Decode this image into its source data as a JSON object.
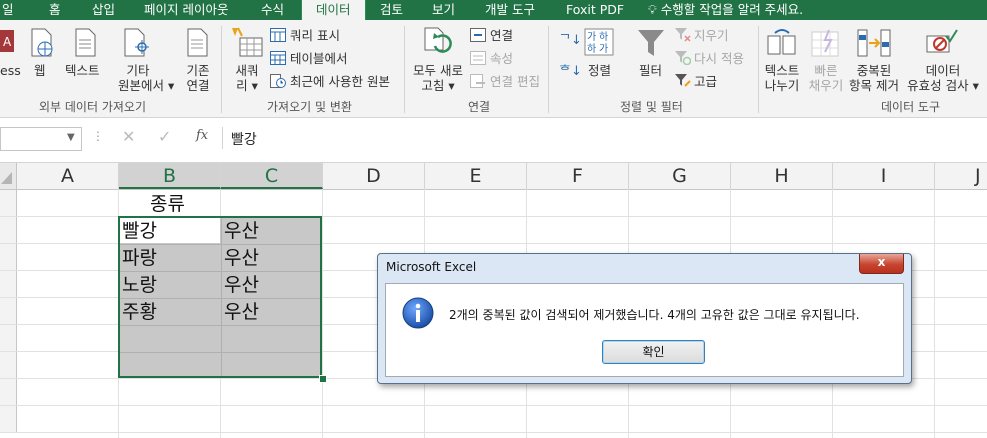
{
  "tabs": [
    {
      "label": "일"
    },
    {
      "label": "홈"
    },
    {
      "label": "삽입"
    },
    {
      "label": "페이지 레이아웃"
    },
    {
      "label": "수식"
    },
    {
      "label": "데이터"
    },
    {
      "label": "검토"
    },
    {
      "label": "보기"
    },
    {
      "label": "개발 도구"
    },
    {
      "label": "Foxit PDF"
    }
  ],
  "tell_me": "수행할 작업을 알려 주세요.",
  "ribbon": {
    "ext": {
      "access": "ess",
      "web": "웹",
      "text": "텍스트",
      "other": [
        "기타",
        "원본에서 ▾"
      ],
      "existing": [
        "기존",
        "연결"
      ],
      "group": "외부 데이터 가져오기"
    },
    "get": {
      "new": [
        "새쿼",
        "리 ▾"
      ],
      "show_query": "쿼리 표시",
      "from_table": "테이블에서",
      "recent": "최근에 사용한 원본",
      "group": "가져오기 및 변환"
    },
    "conn": {
      "refresh": [
        "모두 새로",
        "고침 ▾"
      ],
      "connections": "연결",
      "properties": "속성",
      "edit_links": "연결 편집",
      "group": "연결"
    },
    "sort": {
      "sort": "정렬",
      "filter": "필터",
      "clear": "지우기",
      "reapply": "다시 적용",
      "advanced": "고급",
      "group": "정렬 및 필터"
    },
    "tools": {
      "text_to_col": [
        "텍스트",
        "나누기"
      ],
      "flash": [
        "빠른",
        "채우기"
      ],
      "remove_dup": [
        "중복된",
        "항목 제거"
      ],
      "validation": [
        "데이터",
        "유효성 검사 ▾"
      ],
      "group": "데이터 도구"
    }
  },
  "formula_bar": {
    "fx": "fx",
    "value": "빨강"
  },
  "columns": [
    "A",
    "B",
    "C",
    "D",
    "E",
    "F",
    "G",
    "H",
    "I",
    "J"
  ],
  "cells": {
    "header": "종류",
    "rows": [
      {
        "b": "빨강",
        "c": "우산"
      },
      {
        "b": "파랑",
        "c": "우산"
      },
      {
        "b": "노랑",
        "c": "우산"
      },
      {
        "b": "주황",
        "c": "우산"
      }
    ]
  },
  "dialog": {
    "title": "Microsoft Excel",
    "message": "2개의 중복된 값이 검색되어 제거했습니다. 4개의 고유한 값은 그대로 유지됩니다.",
    "ok": "확인",
    "close": "x"
  },
  "colors": {
    "excel_green": "#217346",
    "selection": "#c8c8c8"
  }
}
